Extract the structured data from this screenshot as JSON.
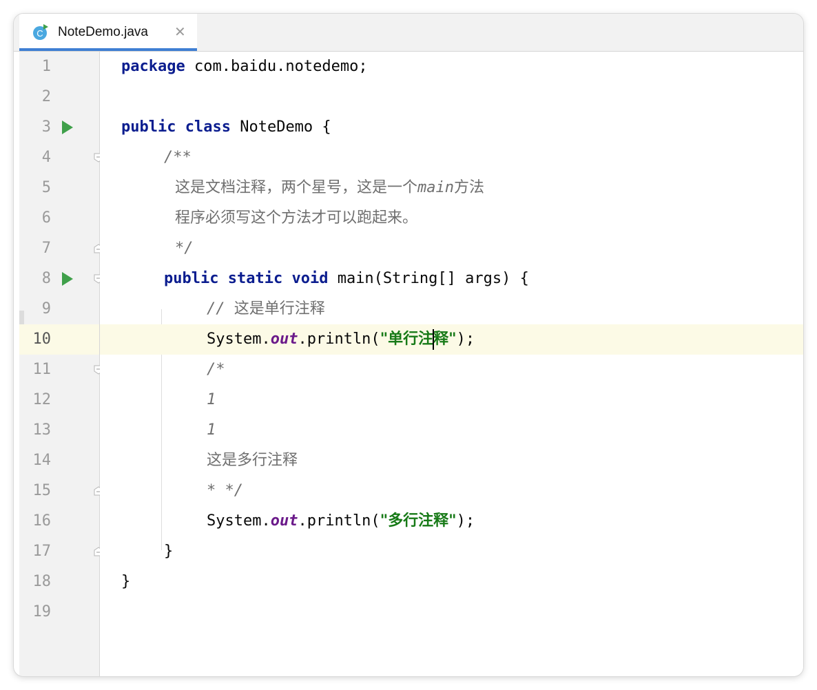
{
  "tab": {
    "filename": "NoteDemo.java",
    "icon": "java-class-icon",
    "close_glyph": "✕"
  },
  "lines": [
    {
      "n": "1"
    },
    {
      "n": "2"
    },
    {
      "n": "3"
    },
    {
      "n": "4"
    },
    {
      "n": "5"
    },
    {
      "n": "6"
    },
    {
      "n": "7"
    },
    {
      "n": "8"
    },
    {
      "n": "9"
    },
    {
      "n": "10"
    },
    {
      "n": "11"
    },
    {
      "n": "12"
    },
    {
      "n": "13"
    },
    {
      "n": "14"
    },
    {
      "n": "15"
    },
    {
      "n": "16"
    },
    {
      "n": "17"
    },
    {
      "n": "18"
    },
    {
      "n": "19"
    }
  ],
  "code": {
    "l1": {
      "kw": "package",
      "rest": " com.baidu.notedemo;"
    },
    "l3": {
      "kw1": "public",
      "kw2": "class",
      "rest": " NoteDemo {"
    },
    "l4": {
      "text": "/**"
    },
    "l5": {
      "text_a": "这是文档注释，两个星号，这是一个",
      "text_b": "main",
      "text_c": "方法"
    },
    "l6": {
      "text": "程序必须写这个方法才可以跑起来。"
    },
    "l7": {
      "text": "*/"
    },
    "l8": {
      "kw1": "public",
      "kw2": "static",
      "kw3": "void",
      "rest": " main(String[] args) {"
    },
    "l9": {
      "text_a": "// ",
      "text_b": "这是单行注释"
    },
    "l10": {
      "pre": "System.",
      "field": "out",
      "mid": ".println(",
      "str_a": "\"单行注",
      "str_b": "释\"",
      "post": ");"
    },
    "l11": {
      "text": "/*"
    },
    "l12": {
      "text": "1"
    },
    "l13": {
      "text": "1"
    },
    "l14": {
      "text": "这是多行注释"
    },
    "l15": {
      "text": "* */"
    },
    "l16": {
      "pre": "System.",
      "field": "out",
      "mid": ".println(",
      "str": "\"多行注释\"",
      "post": ");"
    },
    "l17": {
      "text": "}"
    },
    "l18": {
      "text": "}"
    }
  },
  "colors": {
    "accent": "#3f7fd3",
    "run": "#3fa04a",
    "keyword": "#0b1d8f",
    "string": "#177a17",
    "current_line": "#fcfae6"
  }
}
